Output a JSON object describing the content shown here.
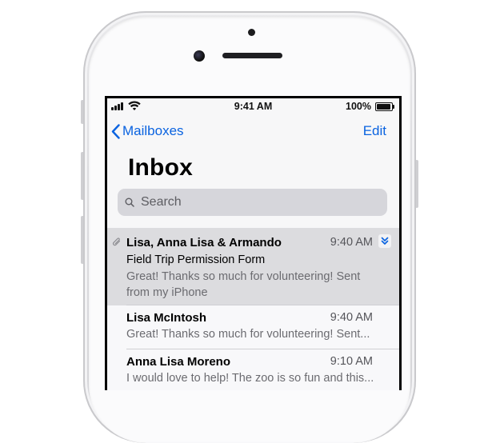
{
  "status_bar": {
    "time": "9:41 AM",
    "battery": "100%"
  },
  "nav": {
    "back_label": "Mailboxes",
    "edit_label": "Edit",
    "title": "Inbox"
  },
  "search": {
    "placeholder": "Search"
  },
  "messages": [
    {
      "sender": "Lisa, Anna Lisa & Armando",
      "time": "9:40 AM",
      "subject": "Field Trip Permission Form",
      "preview_line1": "Great! Thanks so much for volunteering! Sent",
      "preview_line2": "from my iPhone",
      "has_attachment": true,
      "thread": true,
      "selected": true
    },
    {
      "sender": "Lisa McIntosh",
      "time": "9:40 AM",
      "preview": "Great! Thanks so much for volunteering! Sent..."
    },
    {
      "sender": "Anna Lisa Moreno",
      "time": "9:10 AM",
      "preview": "I would love to help! The zoo is so fun and this..."
    }
  ],
  "colors": {
    "accent": "#0a63e0",
    "selected_row": "#dcdcdf",
    "search_field": "#d6d6db"
  }
}
